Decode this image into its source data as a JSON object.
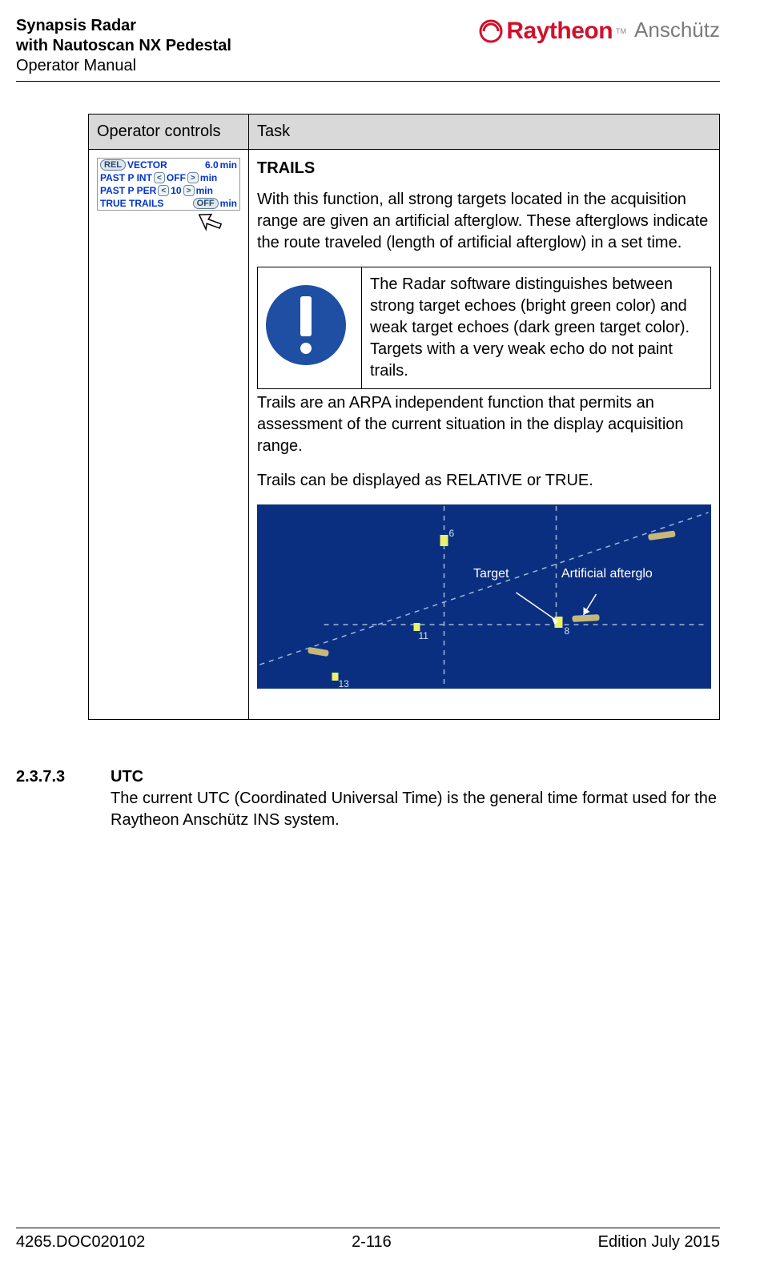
{
  "header": {
    "line1": "Synapsis Radar",
    "line2": "with Nautoscan NX Pedestal",
    "line3": "Operator Manual",
    "logo_raytheon": "Raytheon",
    "logo_anschutz": "Anschütz"
  },
  "table": {
    "col1_header": "Operator controls",
    "col2_header": "Task",
    "op_panel": {
      "row1": {
        "pill": "REL",
        "label": "VECTOR",
        "val": "6.0",
        "unit": "min"
      },
      "row2": {
        "label": "PAST P INT",
        "val": "OFF",
        "unit": "min"
      },
      "row3": {
        "label": "PAST P PER",
        "val": "10",
        "unit": "min"
      },
      "row4": {
        "label": "TRUE TRAILS",
        "val": "OFF",
        "unit": "min"
      }
    },
    "task": {
      "title": "TRAILS",
      "p1": "With this function, all strong targets located in the acquisition range are given an artificial afterglow. These afterglows indicate the route traveled (length of artificial afterglow) in a set time.",
      "info": "The Radar software distinguishes between strong target echoes (bright green color) and weak target echoes (dark green target color). Targets with a very weak echo do not paint trails.",
      "p2": "Trails are an ARPA independent function that permits an assessment of the current situation in the display acquisition range.",
      "p3": "Trails can be displayed as RELATIVE or TRUE.",
      "fig": {
        "label_target": "Target",
        "label_afterglow": "Artificial afterglo",
        "n6": "6",
        "n8": "8",
        "n11": "11",
        "n13": "13"
      }
    }
  },
  "section": {
    "num": "2.3.7.3",
    "title": "UTC",
    "body": "The current UTC (Coordinated Universal Time) is the general time format used for the Raytheon Anschütz INS system."
  },
  "footer": {
    "left": "4265.DOC020102",
    "center": "2-116",
    "right": "Edition July 2015"
  }
}
